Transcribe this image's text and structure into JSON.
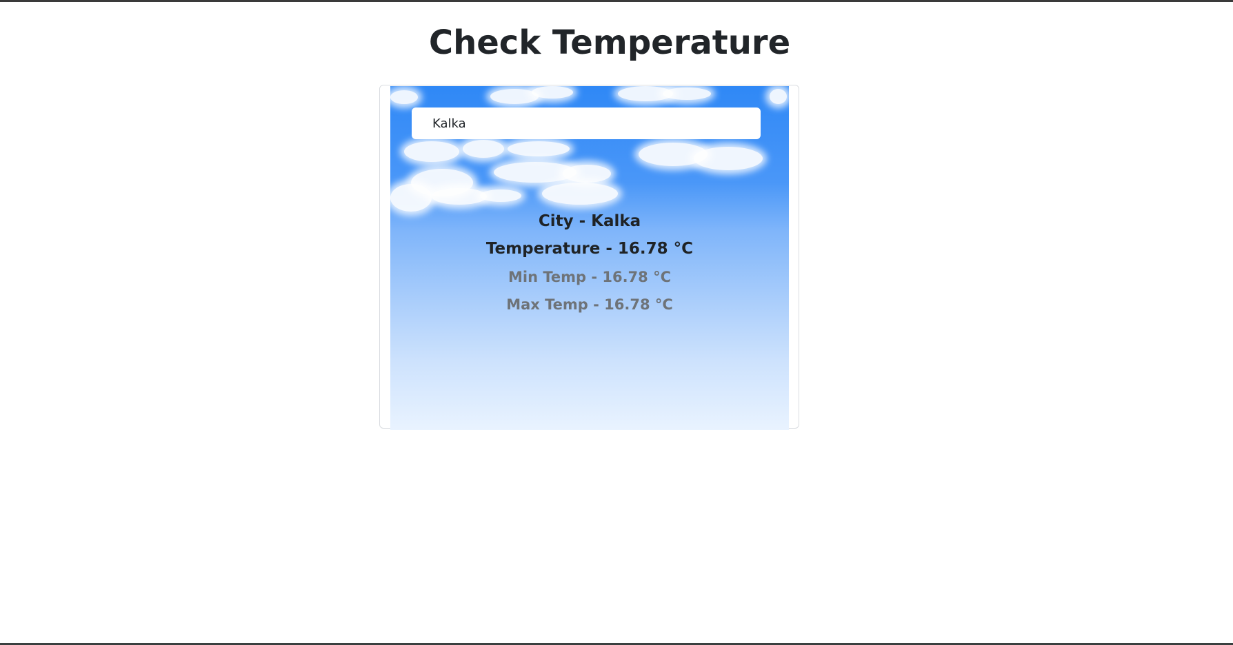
{
  "page": {
    "title": "Check Temperature"
  },
  "search": {
    "value": "Kalka"
  },
  "weather": {
    "city_line": "City - Kalka",
    "temperature_line": "Temperature - 16.78 °C",
    "min_temp_line": "Min Temp - 16.78 °C",
    "max_temp_line": "Max Temp - 16.78 °C"
  },
  "colors": {
    "sky_top": "#2f88f6",
    "sky_bottom": "#e9f3ff",
    "title_text": "#212529",
    "secondary_text": "#6e7378"
  }
}
